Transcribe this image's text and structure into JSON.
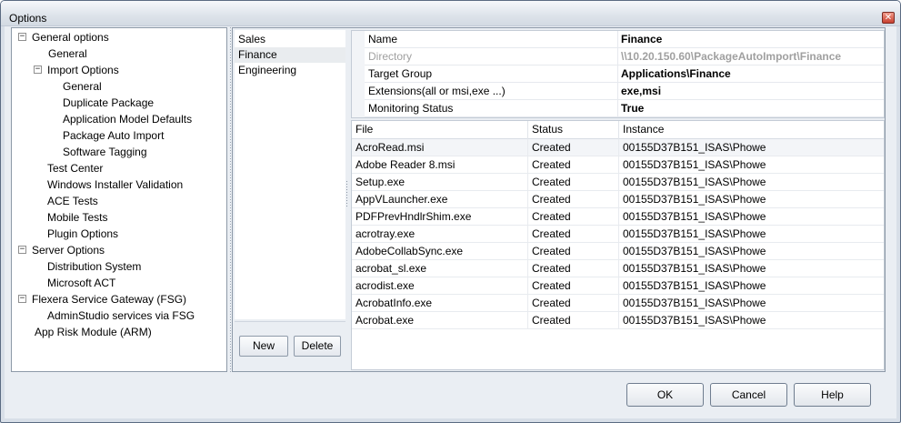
{
  "window": {
    "title": "Options",
    "close_glyph": "✕"
  },
  "tree": {
    "items": [
      {
        "label": "General options",
        "expander": "−"
      },
      {
        "label": "General"
      },
      {
        "label": "Import Options",
        "expander": "−"
      },
      {
        "label": "General"
      },
      {
        "label": "Duplicate Package"
      },
      {
        "label": "Application Model Defaults"
      },
      {
        "label": "Package Auto Import"
      },
      {
        "label": "Software Tagging"
      },
      {
        "label": "Test Center"
      },
      {
        "label": "Windows Installer Validation"
      },
      {
        "label": "ACE Tests"
      },
      {
        "label": "Mobile Tests"
      },
      {
        "label": "Plugin Options"
      },
      {
        "label": "Server Options",
        "expander": "−"
      },
      {
        "label": "Distribution System"
      },
      {
        "label": "Microsoft ACT"
      },
      {
        "label": "Flexera Service Gateway (FSG)",
        "expander": "−"
      },
      {
        "label": "AdminStudio services via FSG"
      },
      {
        "label": "App Risk Module (ARM)"
      }
    ]
  },
  "packages": {
    "items": [
      "Sales",
      "Finance",
      "Engineering"
    ],
    "selected": "Finance",
    "new_label": "New",
    "delete_label": "Delete"
  },
  "properties": [
    {
      "name": "Name",
      "value": "Finance"
    },
    {
      "name": "Directory",
      "value": "\\\\10.20.150.60\\PackageAutoImport\\Finance",
      "disabled": true
    },
    {
      "name": "Target Group",
      "value": "Applications\\Finance"
    },
    {
      "name": "Extensions(all or msi,exe ...)",
      "value": "exe,msi"
    },
    {
      "name": "Monitoring Status",
      "value": "True"
    }
  ],
  "files": {
    "columns": [
      "File",
      "Status",
      "Instance"
    ],
    "rows": [
      [
        "AcroRead.msi",
        "Created",
        "00155D37B151_ISAS\\Phowe"
      ],
      [
        "Adobe Reader 8.msi",
        "Created",
        "00155D37B151_ISAS\\Phowe"
      ],
      [
        "Setup.exe",
        "Created",
        "00155D37B151_ISAS\\Phowe"
      ],
      [
        "AppVLauncher.exe",
        "Created",
        "00155D37B151_ISAS\\Phowe"
      ],
      [
        "PDFPrevHndlrShim.exe",
        "Created",
        "00155D37B151_ISAS\\Phowe"
      ],
      [
        "acrotray.exe",
        "Created",
        "00155D37B151_ISAS\\Phowe"
      ],
      [
        "AdobeCollabSync.exe",
        "Created",
        "00155D37B151_ISAS\\Phowe"
      ],
      [
        "acrobat_sl.exe",
        "Created",
        "00155D37B151_ISAS\\Phowe"
      ],
      [
        "acrodist.exe",
        "Created",
        "00155D37B151_ISAS\\Phowe"
      ],
      [
        "AcrobatInfo.exe",
        "Created",
        "00155D37B151_ISAS\\Phowe"
      ],
      [
        "Acrobat.exe",
        "Created",
        "00155D37B151_ISAS\\Phowe"
      ]
    ]
  },
  "footer": {
    "ok_label": "OK",
    "cancel_label": "Cancel",
    "help_label": "Help"
  }
}
